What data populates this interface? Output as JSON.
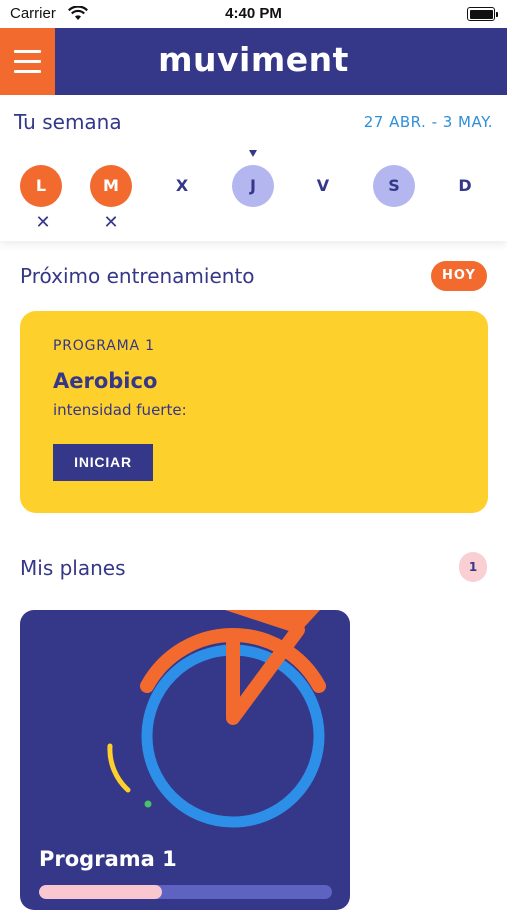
{
  "status_bar": {
    "carrier": "Carrier",
    "time": "4:40 PM"
  },
  "header": {
    "logo": "muviment",
    "menu_icon": "hamburger-menu-icon",
    "colors": {
      "brand": "#353788",
      "accent": "#f26a2e"
    }
  },
  "week": {
    "title": "Tu semana",
    "range": "27 ABR. - 3 MAY.",
    "days": [
      {
        "label": "L",
        "state": "done",
        "mark": "✕"
      },
      {
        "label": "M",
        "state": "done",
        "mark": "✕"
      },
      {
        "label": "X",
        "state": "none",
        "mark": ""
      },
      {
        "label": "J",
        "state": "planned",
        "mark": ""
      },
      {
        "label": "V",
        "state": "none",
        "mark": ""
      },
      {
        "label": "S",
        "state": "planned",
        "mark": ""
      },
      {
        "label": "D",
        "state": "none",
        "mark": ""
      }
    ]
  },
  "next_training": {
    "title": "Próximo entrenamiento",
    "badge": "HOY",
    "program_label": "PROGRAMA 1",
    "workout": "Aerobico",
    "intensity": "intensidad fuerte:",
    "start_label": "INICIAR"
  },
  "plans": {
    "title": "Mis planes",
    "count": "1",
    "items": [
      {
        "name": "Programa 1",
        "progress": 0.42
      }
    ]
  }
}
